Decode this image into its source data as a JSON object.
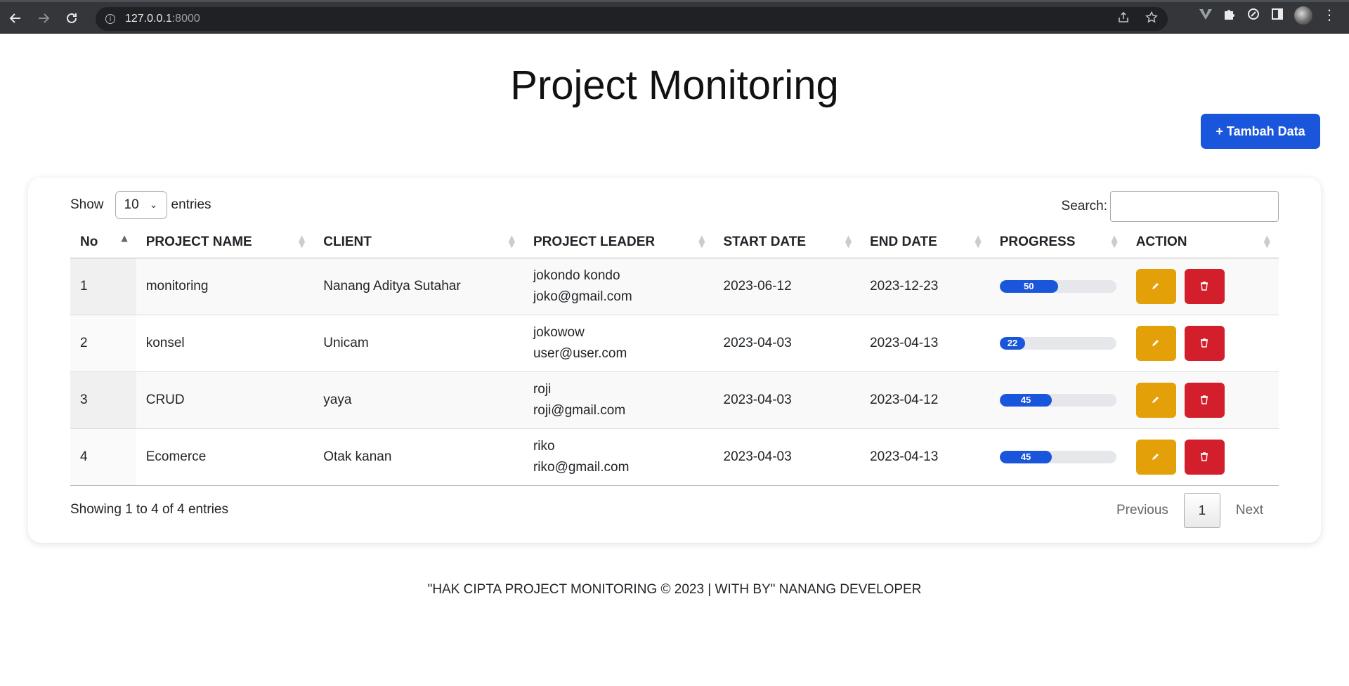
{
  "browser": {
    "url_host": "127.0.0.1",
    "url_port": ":8000"
  },
  "page": {
    "title": "Project Monitoring",
    "add_button_label": "+ Tambah Data"
  },
  "table_controls": {
    "show_label": "Show",
    "entries_value": "10",
    "entries_label": "entries",
    "search_label": "Search:",
    "search_value": ""
  },
  "table": {
    "columns": [
      "No",
      "PROJECT NAME",
      "CLIENT",
      "PROJECT LEADER",
      "START DATE",
      "END DATE",
      "PROGRESS",
      "ACTION"
    ],
    "rows": [
      {
        "no": "1",
        "project": "monitoring",
        "client": "Nanang Aditya Sutahar",
        "leader_name": "jokondo kondo",
        "leader_email": "joko@gmail.com",
        "start": "2023-06-12",
        "end": "2023-12-23",
        "progress": 50
      },
      {
        "no": "2",
        "project": "konsel",
        "client": "Unicam",
        "leader_name": "jokowow",
        "leader_email": "user@user.com",
        "start": "2023-04-03",
        "end": "2023-04-13",
        "progress": 22
      },
      {
        "no": "3",
        "project": "CRUD",
        "client": "yaya",
        "leader_name": "roji",
        "leader_email": "roji@gmail.com",
        "start": "2023-04-03",
        "end": "2023-04-12",
        "progress": 45
      },
      {
        "no": "4",
        "project": "Ecomerce",
        "client": "Otak kanan",
        "leader_name": "riko",
        "leader_email": "riko@gmail.com",
        "start": "2023-04-03",
        "end": "2023-04-13",
        "progress": 45
      }
    ]
  },
  "pagination": {
    "info": "Showing 1 to 4 of 4 entries",
    "previous": "Previous",
    "current": "1",
    "next": "Next"
  },
  "footer": {
    "text": "\"HAK CIPTA PROJECT MONITORING © 2023 | WITH BY\" NANANG DEVELOPER"
  },
  "colors": {
    "primary": "#1a56db",
    "edit": "#e3a008",
    "delete": "#d21f2b"
  },
  "icons": [
    "back-arrow-icon",
    "forward-arrow-icon",
    "reload-icon",
    "info-icon",
    "share-icon",
    "star-icon",
    "extension-v-icon",
    "puzzle-icon",
    "sync-icon",
    "side-panel-icon",
    "avatar",
    "kebab-menu-icon",
    "pencil-icon",
    "trash-icon"
  ]
}
